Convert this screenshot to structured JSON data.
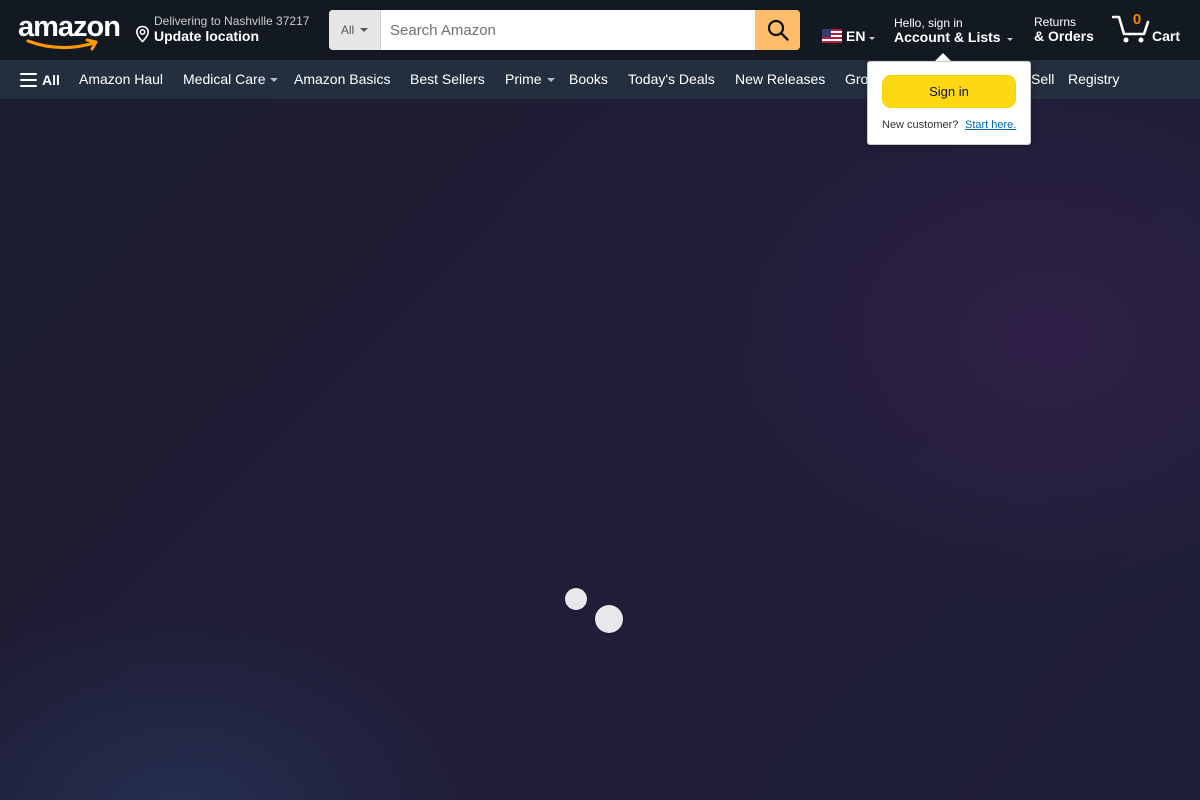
{
  "header": {
    "logo_text": "amazon",
    "delivery": {
      "line1": "Delivering to Nashville 37217",
      "line2": "Update location"
    },
    "search": {
      "category": "All",
      "placeholder": "Search Amazon"
    },
    "language": "EN",
    "account": {
      "line1": "Hello, sign in",
      "line2": "Account & Lists"
    },
    "returns": {
      "line1": "Returns",
      "line2": "& Orders"
    },
    "cart": {
      "count": "0",
      "label": "Cart"
    }
  },
  "nav": {
    "all_label": "All",
    "items": [
      {
        "label": "Amazon Haul"
      },
      {
        "label": "Medical Care"
      },
      {
        "label": "Amazon Basics"
      },
      {
        "label": "Best Sellers"
      },
      {
        "label": "Prime"
      },
      {
        "label": "Books"
      },
      {
        "label": "Today's Deals"
      },
      {
        "label": "New Releases"
      },
      {
        "label": "Gro"
      },
      {
        "label": "Sell"
      },
      {
        "label": "Registry"
      }
    ]
  },
  "signin_popover": {
    "button_label": "Sign in",
    "new_customer_text": "New customer?",
    "start_link": "Start here."
  },
  "colors": {
    "header_bg": "#131921",
    "nav_bg": "#232f3e",
    "search_button": "#febd69",
    "signin_button": "#ffd814",
    "cart_count": "#f08804",
    "link": "#0066c0"
  },
  "icons": [
    "amazon-smile-icon",
    "location-pin-icon",
    "search-icon",
    "us-flag-icon",
    "cart-icon",
    "hamburger-icon",
    "loading-spinner"
  ]
}
